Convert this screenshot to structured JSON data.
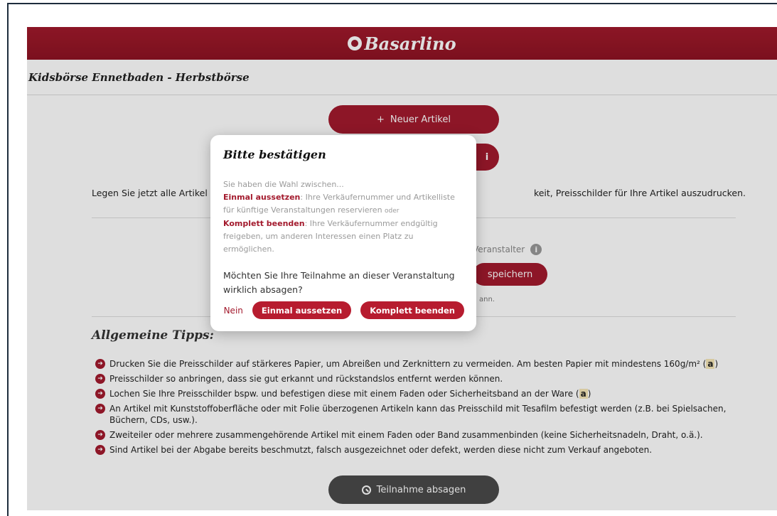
{
  "brand": {
    "name": "Basarlino"
  },
  "event": {
    "title": "Kidsbörse Ennetbaden - Herbstbörse"
  },
  "actions": {
    "new_article": "Neuer Artikel",
    "info": "i",
    "save": "speichern",
    "cancel_participation": "Teilnahme absagen"
  },
  "intro": {
    "left": "Legen Sie jetzt alle Artikel an",
    "right": "keit, Preisschilder für Ihre Artikel auszudrucken."
  },
  "settings": {
    "veranstalter_label": "Veranstalter",
    "note": "ann."
  },
  "tips": {
    "heading": "Allgemeine Tipps:",
    "items": [
      {
        "text": "Drucken Sie die Preisschilder auf stärkeres Papier, um Abreißen und Zerknittern zu vermeiden. Am besten Papier mit mindestens 160g/m² (",
        "ref": "a",
        "tail": ")"
      },
      {
        "text": "Preisschilder so anbringen, dass sie gut erkannt und rückstandslos entfernt werden können."
      },
      {
        "text": "Lochen Sie Ihre Preisschilder bspw. und befestigen diese mit einem Faden oder Sicherheitsband an der Ware (",
        "ref": "a",
        "tail": ")"
      },
      {
        "text": "An Artikel mit Kunststoffoberfläche oder mit Folie überzogenen Artikeln kann das Preisschild mit Tesafilm befestigt werden (z.B. bei Spielsachen, Büchern, CDs, usw.)."
      },
      {
        "text": "Zweiteiler oder mehrere zusammengehörende Artikel mit einem Faden oder Band zusammenbinden (keine Sicherheitsnadeln, Draht, o.ä.)."
      },
      {
        "text": "Sind Artikel bei der Abgabe bereits beschmutzt, falsch ausgezeichnet oder defekt, werden diese nicht zum Verkauf angeboten."
      }
    ]
  },
  "modal": {
    "title": "Bitte bestätigen",
    "intro": "Sie haben die Wahl zwischen...",
    "option1_label": "Einmal aussetzen",
    "option1_text": ": Ihre Verkäufernummer und Artikelliste für künftige Veranstaltungen reservieren ",
    "or": "oder",
    "option2_label": "Komplett beenden",
    "option2_text": ": Ihre Verkäufernummer endgültig freigeben, um anderen Interessen einen Platz zu ermöglichen.",
    "question": "Möchten Sie Ihre Teilnahme an dieser Veranstaltung wirklich absagen?",
    "no": "Nein",
    "pause": "Einmal aussetzen",
    "end": "Komplett beenden"
  },
  "colors": {
    "accent": "#a31a2d",
    "dark_button": "#4a4a4a"
  }
}
